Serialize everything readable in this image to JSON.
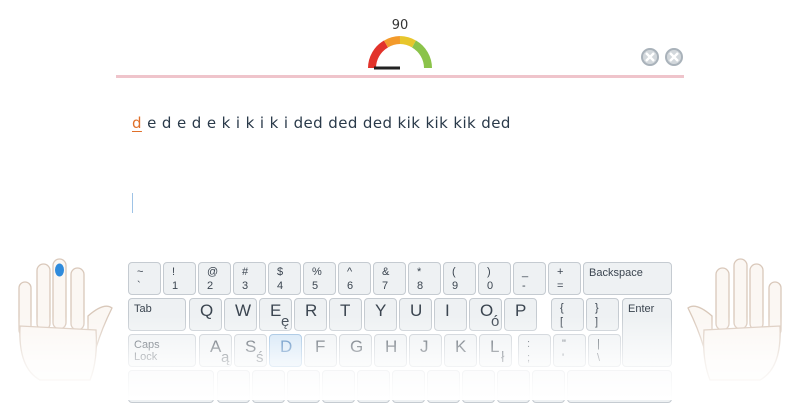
{
  "gauge": {
    "value": "90",
    "level": 0.9,
    "icon": "speed-gauge-icon"
  },
  "colors": {
    "divider": "#efc4cb",
    "cursor_letter": "#e0702a",
    "active_key": "#cfe3f5",
    "active_finger": "#2f8bdc"
  },
  "lesson": {
    "current": "d",
    "rest": " e d e d e k i k i k i ded ded ded kik kik kik ded"
  },
  "window_buttons": [
    {
      "icon": "close-circle-icon"
    },
    {
      "icon": "close-circle-icon"
    }
  ],
  "keyboard": {
    "row1": [
      {
        "top": "~",
        "bottom": "`"
      },
      {
        "top": "!",
        "bottom": "1"
      },
      {
        "top": "@",
        "bottom": "2"
      },
      {
        "top": "#",
        "bottom": "3"
      },
      {
        "top": "$",
        "bottom": "4"
      },
      {
        "top": "%",
        "bottom": "5"
      },
      {
        "top": "^",
        "bottom": "6"
      },
      {
        "top": "&",
        "bottom": "7"
      },
      {
        "top": "*",
        "bottom": "8"
      },
      {
        "top": "(",
        "bottom": "9"
      },
      {
        "top": ")",
        "bottom": "0"
      },
      {
        "top": "_",
        "bottom": "-"
      },
      {
        "top": "+",
        "bottom": "="
      }
    ],
    "backspace": "Backspace",
    "tab": "Tab",
    "row2": [
      {
        "main": "Q",
        "alt": ""
      },
      {
        "main": "W",
        "alt": ""
      },
      {
        "main": "E",
        "alt": "ę"
      },
      {
        "main": "R",
        "alt": ""
      },
      {
        "main": "T",
        "alt": ""
      },
      {
        "main": "Y",
        "alt": ""
      },
      {
        "main": "U",
        "alt": ""
      },
      {
        "main": "I",
        "alt": ""
      },
      {
        "main": "O",
        "alt": "ó"
      },
      {
        "main": "P",
        "alt": ""
      }
    ],
    "row2_brackets": [
      {
        "top": "{",
        "bottom": "["
      },
      {
        "top": "}",
        "bottom": "]"
      }
    ],
    "enter": "Enter",
    "caps": "Caps Lock",
    "row3": [
      {
        "main": "A",
        "alt": "ą"
      },
      {
        "main": "S",
        "alt": "ś"
      },
      {
        "main": "D",
        "alt": ""
      },
      {
        "main": "F",
        "alt": ""
      },
      {
        "main": "G",
        "alt": ""
      },
      {
        "main": "H",
        "alt": ""
      },
      {
        "main": "J",
        "alt": ""
      },
      {
        "main": "K",
        "alt": ""
      },
      {
        "main": "L",
        "alt": "ł"
      }
    ],
    "row3_punct": [
      {
        "top": ":",
        "bottom": ";"
      },
      {
        "top": "\"",
        "bottom": "'"
      },
      {
        "top": "|",
        "bottom": "\\"
      }
    ],
    "active_key": "D"
  },
  "hands": {
    "left_icon": "left-hand-icon",
    "right_icon": "right-hand-icon",
    "active_finger": "left-middle-finger"
  }
}
